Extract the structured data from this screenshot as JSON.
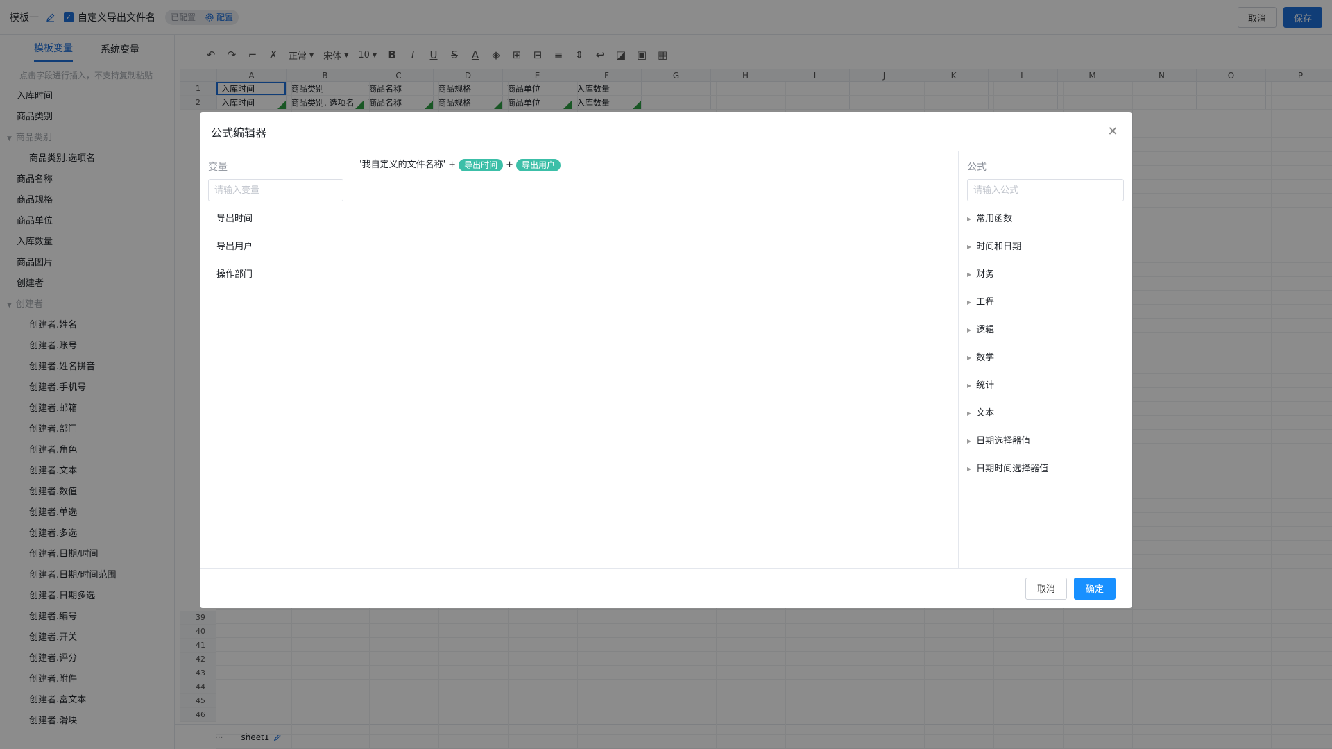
{
  "topbar": {
    "template_name": "模板一",
    "custom_export_label": "自定义导出文件名",
    "config_status": "已配置",
    "config_link": "配置",
    "cancel": "取消",
    "save": "保存"
  },
  "sidebar": {
    "tabs": [
      "模板变量",
      "系统变量"
    ],
    "hint": "点击字段进行插入，不支持复制粘贴",
    "items": [
      {
        "label": "入库时间",
        "kind": "item"
      },
      {
        "label": "商品类别",
        "kind": "item"
      },
      {
        "label": "商品类别",
        "kind": "group"
      },
      {
        "label": "商品类别.选项名",
        "kind": "sub"
      },
      {
        "label": "商品名称",
        "kind": "item"
      },
      {
        "label": "商品规格",
        "kind": "item"
      },
      {
        "label": "商品单位",
        "kind": "item"
      },
      {
        "label": "入库数量",
        "kind": "item"
      },
      {
        "label": "商品图片",
        "kind": "item"
      },
      {
        "label": "创建者",
        "kind": "item"
      },
      {
        "label": "创建者",
        "kind": "group"
      },
      {
        "label": "创建者.姓名",
        "kind": "sub"
      },
      {
        "label": "创建者.账号",
        "kind": "sub"
      },
      {
        "label": "创建者.姓名拼音",
        "kind": "sub"
      },
      {
        "label": "创建者.手机号",
        "kind": "sub"
      },
      {
        "label": "创建者.邮箱",
        "kind": "sub"
      },
      {
        "label": "创建者.部门",
        "kind": "sub"
      },
      {
        "label": "创建者.角色",
        "kind": "sub"
      },
      {
        "label": "创建者.文本",
        "kind": "sub"
      },
      {
        "label": "创建者.数值",
        "kind": "sub"
      },
      {
        "label": "创建者.单选",
        "kind": "sub"
      },
      {
        "label": "创建者.多选",
        "kind": "sub"
      },
      {
        "label": "创建者.日期/时间",
        "kind": "sub"
      },
      {
        "label": "创建者.日期/时间范围",
        "kind": "sub"
      },
      {
        "label": "创建者.日期多选",
        "kind": "sub"
      },
      {
        "label": "创建者.编号",
        "kind": "sub"
      },
      {
        "label": "创建者.开关",
        "kind": "sub"
      },
      {
        "label": "创建者.评分",
        "kind": "sub"
      },
      {
        "label": "创建者.附件",
        "kind": "sub"
      },
      {
        "label": "创建者.富文本",
        "kind": "sub"
      },
      {
        "label": "创建者.滑块",
        "kind": "sub"
      }
    ]
  },
  "toolbar": {
    "style_select": "正常",
    "font_select": "宋体",
    "size_select": "10"
  },
  "sheet": {
    "columns": [
      "A",
      "B",
      "C",
      "D",
      "E",
      "F",
      "G",
      "H",
      "I",
      "J",
      "K",
      "L",
      "M",
      "N",
      "O",
      "P"
    ],
    "rows": [
      {
        "no": "1",
        "cells": [
          "入库时间",
          "商品类别",
          "商品名称",
          "商品规格",
          "商品单位",
          "入库数量"
        ]
      },
      {
        "no": "2",
        "cells": [
          "入库时间",
          "商品类别. 选项名",
          "商品名称",
          "商品规格",
          "商品单位",
          "入库数量"
        ]
      }
    ],
    "bottom_rows": [
      "39",
      "40",
      "41",
      "42",
      "43",
      "44",
      "45",
      "46"
    ],
    "tab_name": "sheet1",
    "more": "···"
  },
  "dialog": {
    "title": "公式编辑器",
    "variables": {
      "title": "变量",
      "placeholder": "请输入变量",
      "items": [
        "导出时间",
        "导出用户",
        "操作部门"
      ]
    },
    "formula": {
      "literal": "'我自定义的文件名称'",
      "op1": "+",
      "tag1": "导出时间",
      "op2": "+",
      "tag2": "导出用户"
    },
    "functions": {
      "title": "公式",
      "placeholder": "请输入公式",
      "items": [
        "常用函数",
        "时间和日期",
        "财务",
        "工程",
        "逻辑",
        "数学",
        "统计",
        "文本",
        "日期选择器值",
        "日期时间选择器值"
      ]
    },
    "cancel": "取消",
    "ok": "确定"
  }
}
